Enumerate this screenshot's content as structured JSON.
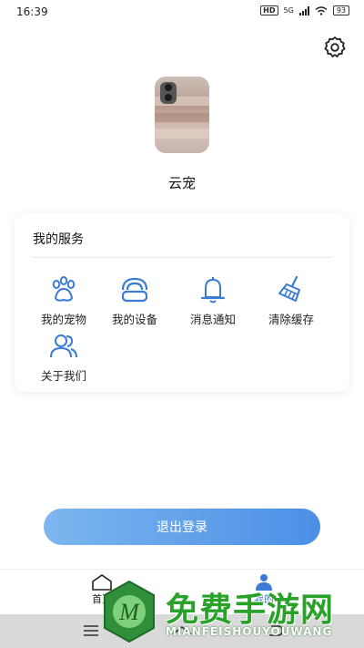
{
  "status": {
    "time": "16:39",
    "hd": "HD",
    "network": "5G",
    "battery": "93"
  },
  "profile": {
    "name": "云宠"
  },
  "services": {
    "title": "我的服务",
    "items": [
      {
        "label": "我的宠物",
        "icon": "paw-icon"
      },
      {
        "label": "我的设备",
        "icon": "device-icon"
      },
      {
        "label": "消息通知",
        "icon": "bell-icon"
      },
      {
        "label": "清除缓存",
        "icon": "broom-icon"
      },
      {
        "label": "关于我们",
        "icon": "users-icon"
      }
    ]
  },
  "logout_label": "退出登录",
  "tabs": [
    {
      "label": "首页",
      "icon": "home-icon"
    },
    {
      "label": "我的",
      "icon": "user-icon"
    }
  ],
  "watermark": {
    "title": "免费手游网",
    "subtitle": "MIANFEISHOUYOUWANG"
  },
  "colors": {
    "accent": "#4b8fe6",
    "icon_blue": "#3a7bd5",
    "watermark_green": "#2aa22a"
  }
}
